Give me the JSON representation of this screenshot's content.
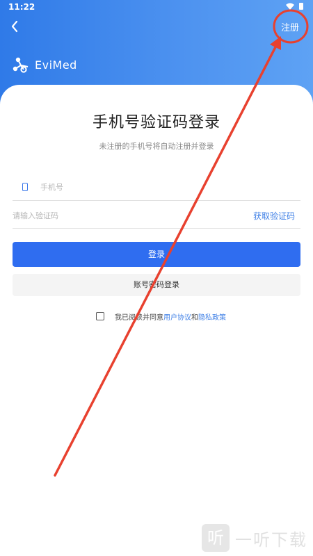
{
  "status_bar": {
    "time": "11:22",
    "icons": "wifi-icon battery-icon"
  },
  "header": {
    "register_label": "注册",
    "brand_name": "EviMed"
  },
  "main": {
    "title": "手机号验证码登录",
    "subtitle": "未注册的手机号将自动注册并登录",
    "phone_placeholder": "手机号",
    "code_placeholder": "请输入验证码",
    "get_code_label": "获取验证码",
    "login_label": "登录",
    "password_login_label": "账号密码登录"
  },
  "agreement": {
    "prefix": "我已阅读并同意",
    "user_agreement": "用户协议",
    "and": "和",
    "privacy_policy": "隐私政策",
    "checked": false
  },
  "watermark": {
    "glyph": "听",
    "text": "一听下载"
  },
  "colors": {
    "primary": "#2f6df0",
    "header_gradient_start": "#2f7ae8",
    "annotation": "#e8412f"
  }
}
